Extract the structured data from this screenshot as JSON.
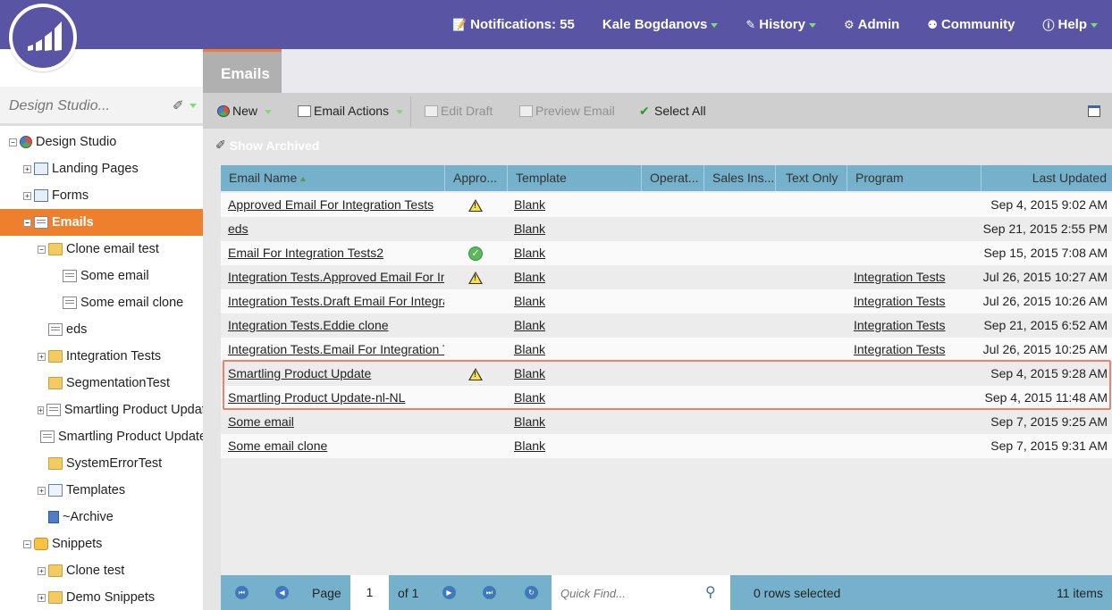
{
  "topnav": {
    "notifications": "Notifications: 55",
    "user": "Kale Bogdanovs",
    "history": "History",
    "admin": "Admin",
    "community": "Community",
    "help": "Help"
  },
  "sidebar": {
    "search_placeholder": "Design Studio...",
    "tree": [
      {
        "label": "Design Studio",
        "icon": "design-studio-icon"
      },
      {
        "label": "Landing Pages",
        "icon": "landing-page-icon"
      },
      {
        "label": "Forms",
        "icon": "form-icon"
      },
      {
        "label": "Emails",
        "icon": "email-icon"
      },
      {
        "label": "Clone email test",
        "icon": "folder-icon"
      },
      {
        "label": "Some email",
        "icon": "email-icon"
      },
      {
        "label": "Some email clone",
        "icon": "email-icon"
      },
      {
        "label": "eds",
        "icon": "email-icon"
      },
      {
        "label": "Integration Tests",
        "icon": "folder-icon"
      },
      {
        "label": "SegmentationTest",
        "icon": "folder-icon"
      },
      {
        "label": "Smartling Product Update",
        "icon": "email-icon"
      },
      {
        "label": "Smartling Product Update",
        "icon": "email-icon"
      },
      {
        "label": "SystemErrorTest",
        "icon": "folder-icon"
      },
      {
        "label": "Templates",
        "icon": "template-icon"
      },
      {
        "label": "~Archive",
        "icon": "archive-icon"
      },
      {
        "label": "Snippets",
        "icon": "snippet-icon"
      },
      {
        "label": "Clone test",
        "icon": "folder-icon"
      },
      {
        "label": "Demo Snippets",
        "icon": "folder-icon"
      }
    ]
  },
  "main": {
    "tab": "Emails",
    "toolbar": {
      "new": "New",
      "email_actions": "Email Actions",
      "edit_draft": "Edit Draft",
      "preview_email": "Preview Email",
      "select_all": "Select All"
    },
    "show_archived": "Show Archived"
  },
  "grid": {
    "columns": [
      "Email Name",
      "Appro...",
      "Template",
      "Operat...",
      "Sales Ins...",
      "Text Only",
      "Program",
      "Last Updated"
    ],
    "rows": [
      {
        "name": "Approved Email For Integration Tests",
        "approval": "warning",
        "template": "Blank",
        "program": "",
        "updated": "Sep 4, 2015 9:02 AM"
      },
      {
        "name": "eds",
        "approval": "",
        "template": "Blank",
        "program": "",
        "updated": "Sep 21, 2015 2:55 PM"
      },
      {
        "name": "Email For Integration Tests2",
        "approval": "approved",
        "template": "Blank",
        "program": "",
        "updated": "Sep 15, 2015 7:08 AM"
      },
      {
        "name": "Integration Tests.Approved Email For Integration Tests",
        "approval": "warning",
        "template": "Blank",
        "program": "Integration Tests",
        "updated": "Jul 26, 2015 10:27 AM"
      },
      {
        "name": "Integration Tests.Draft Email For Integration Tests",
        "approval": "",
        "template": "Blank",
        "program": "Integration Tests",
        "updated": "Jul 26, 2015 10:26 AM"
      },
      {
        "name": "Integration Tests.Eddie clone",
        "approval": "",
        "template": "Blank",
        "program": "Integration Tests",
        "updated": "Sep 21, 2015 6:52 AM"
      },
      {
        "name": "Integration Tests.Email For Integration Tests",
        "approval": "",
        "template": "Blank",
        "program": "Integration Tests",
        "updated": "Jul 26, 2015 10:25 AM"
      },
      {
        "name": "Smartling Product Update",
        "approval": "warning",
        "template": "Blank",
        "program": "",
        "updated": "Sep 4, 2015 9:28 AM"
      },
      {
        "name": "Smartling Product Update-nl-NL",
        "approval": "",
        "template": "Blank",
        "program": "",
        "updated": "Sep 4, 2015 11:48 AM"
      },
      {
        "name": "Some email",
        "approval": "",
        "template": "Blank",
        "program": "",
        "updated": "Sep 7, 2015 9:25 AM"
      },
      {
        "name": "Some email clone",
        "approval": "",
        "template": "Blank",
        "program": "",
        "updated": "Sep 7, 2015 9:31 AM"
      }
    ]
  },
  "footer": {
    "page_label": "Page",
    "page_value": "1",
    "of_label": "of 1",
    "quick_find_placeholder": "Quick Find...",
    "rows_selected": "0 rows selected",
    "items_count": "11 items"
  },
  "colors": {
    "header": "#5a54a4",
    "accent_orange": "#ee7f2d",
    "grid_header": "#76b1cc",
    "highlight_border": "#f0806a"
  }
}
